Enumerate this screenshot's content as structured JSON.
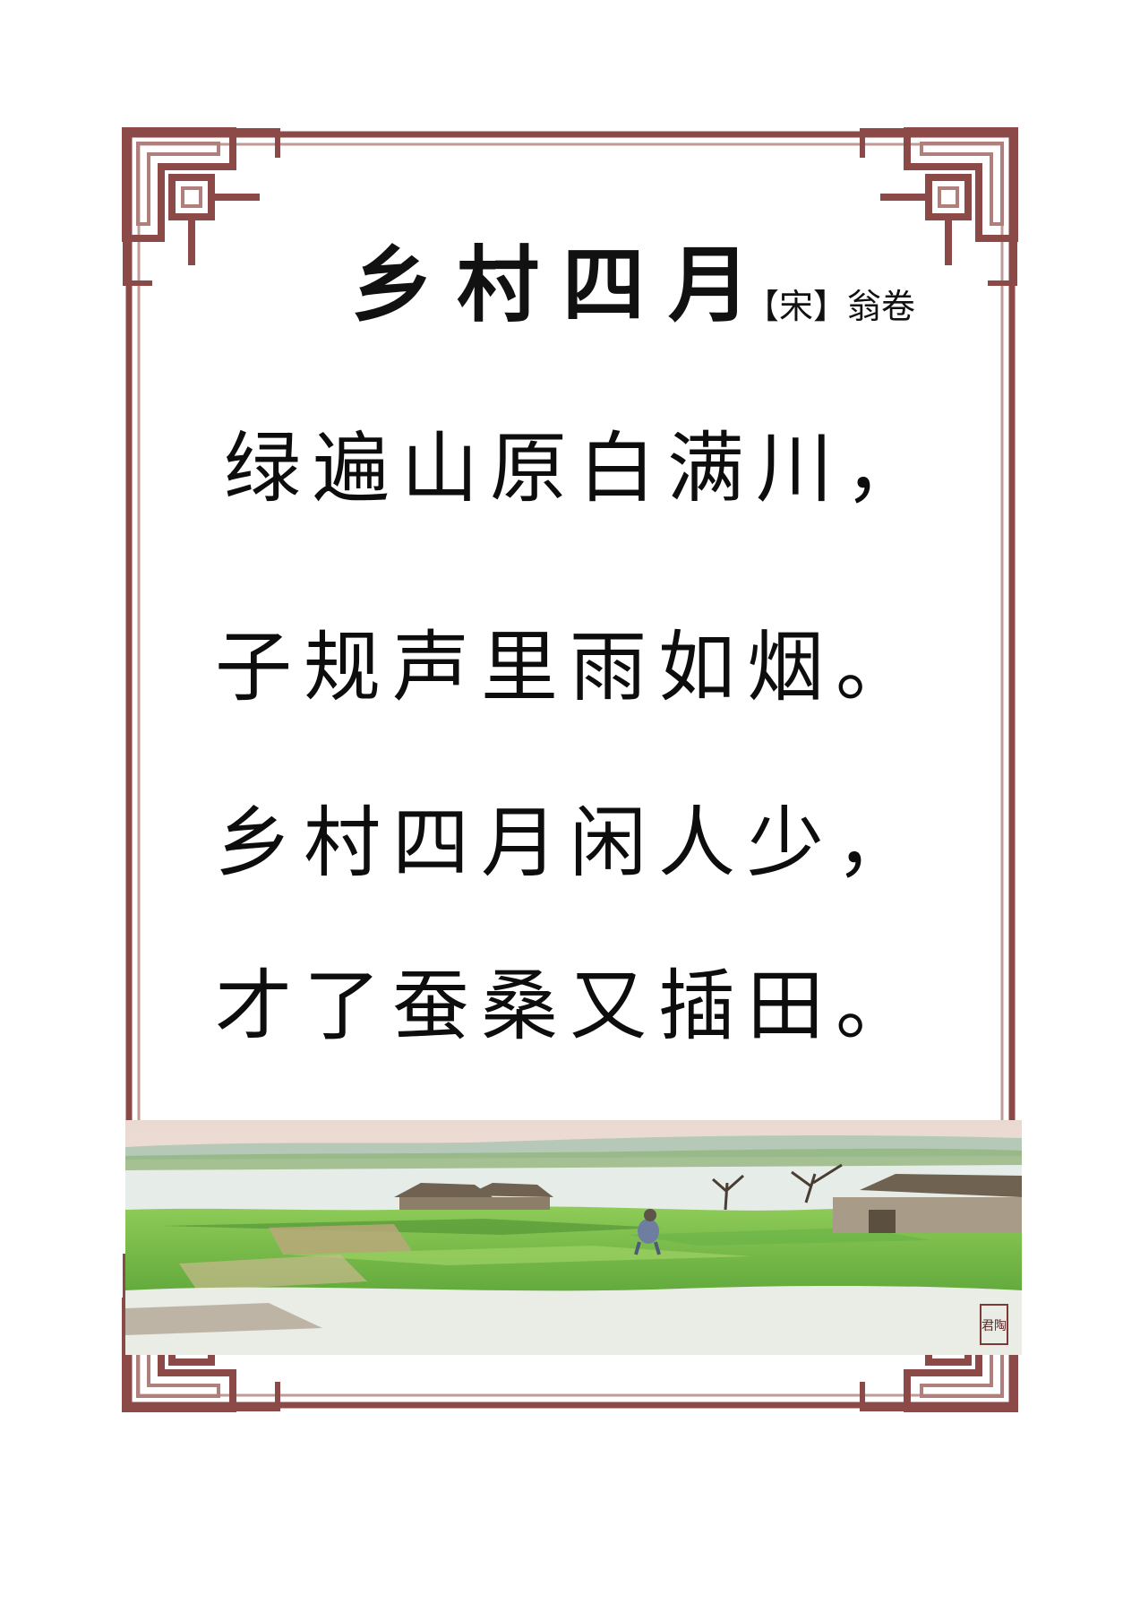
{
  "poem": {
    "title": "乡村四月",
    "author": "【宋】翁卷",
    "lines": [
      "绿遍山原白满川，",
      "子规声里雨如烟。",
      "乡村四月闲人少，",
      "才了蚕桑又插田。"
    ]
  },
  "illustration": {
    "subject": "rural landscape painting with rice paddies, thatched huts and a farmer",
    "seal_text": "君陶"
  },
  "colors": {
    "frame": "#8b4a48",
    "frame_light": "#c09a96",
    "text": "#111111",
    "paddy_green": "#7fc04a",
    "water": "#e6ece8"
  }
}
